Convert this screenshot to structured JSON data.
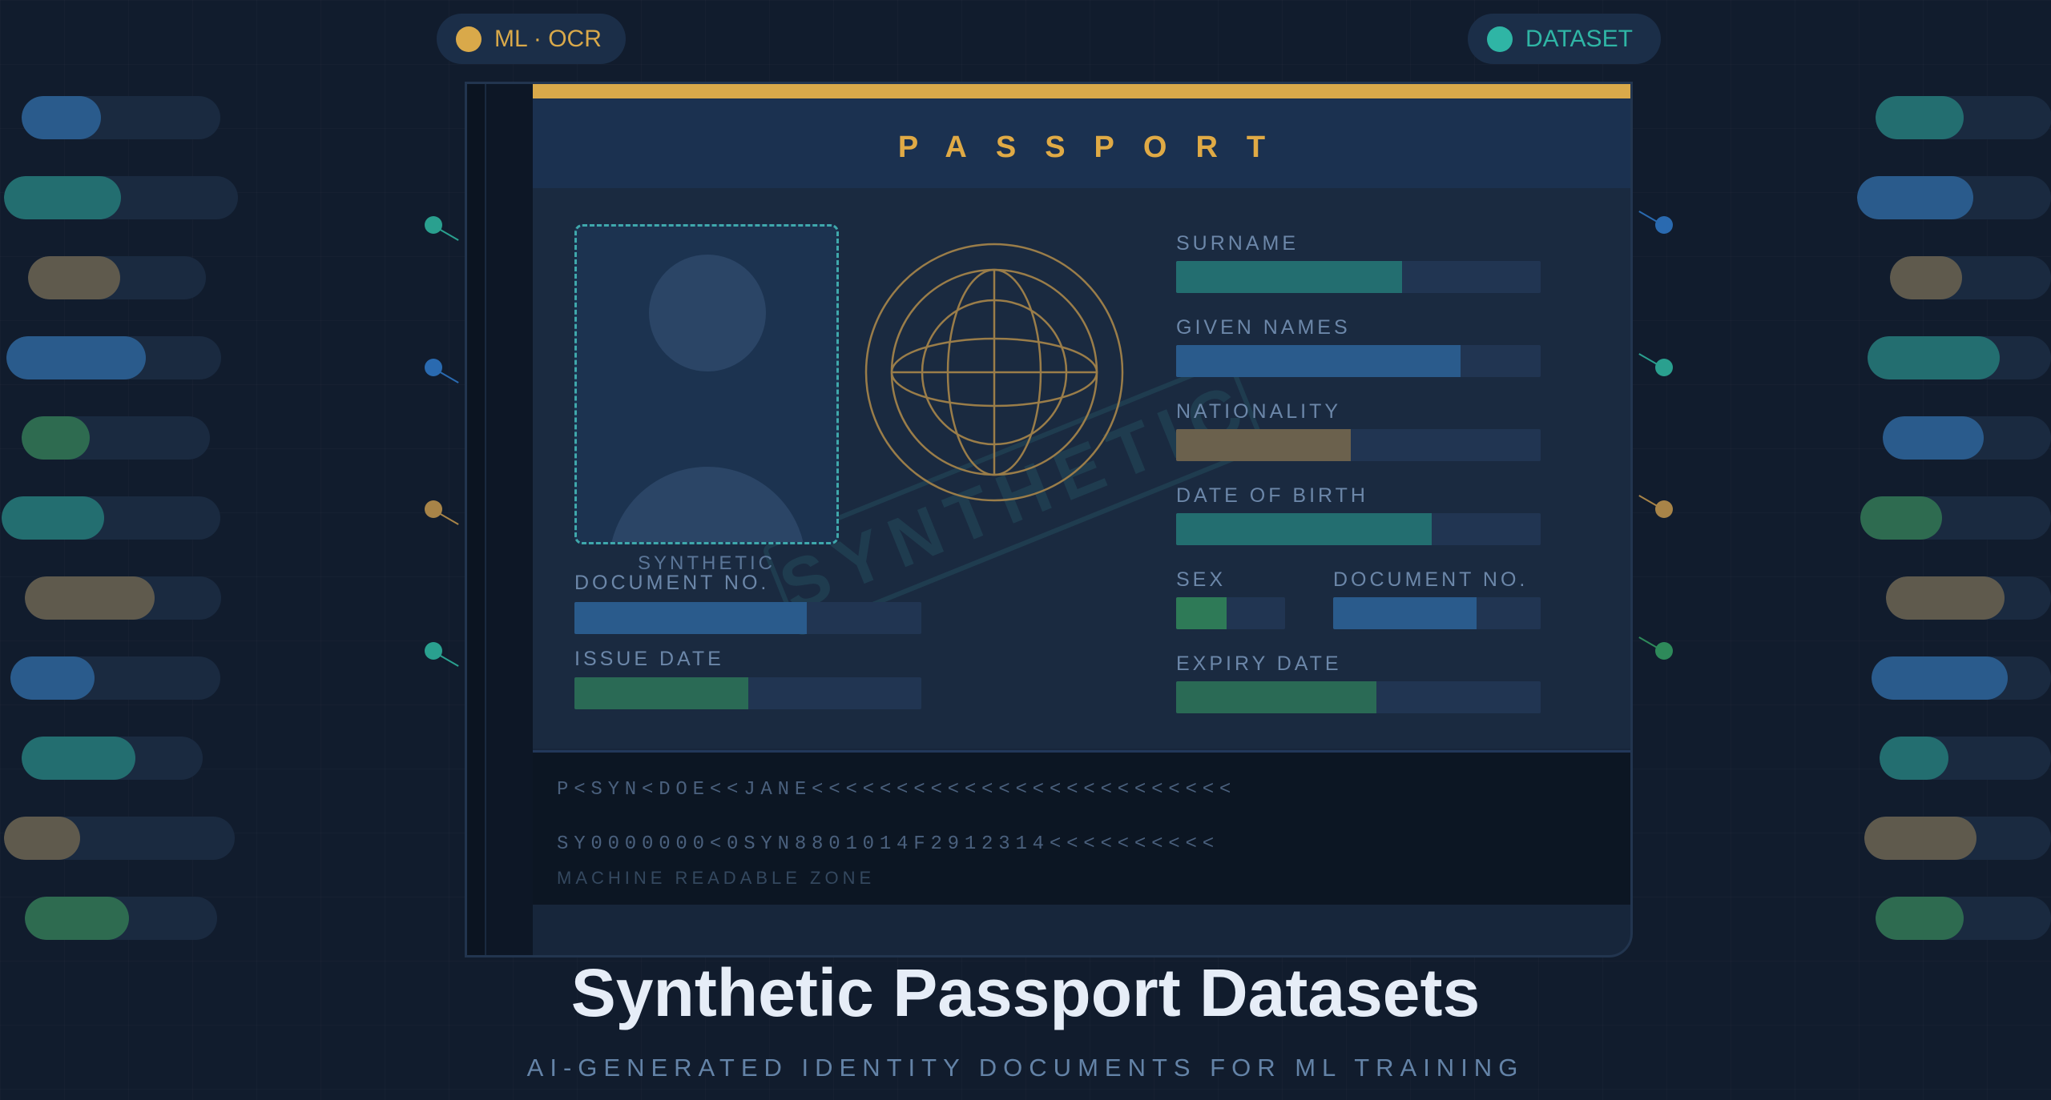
{
  "badges": {
    "left": {
      "label": "ML · OCR",
      "dot_color": "#d9a94a"
    },
    "right": {
      "label": "DATASET",
      "dot_color": "#2fb5a5"
    }
  },
  "passport": {
    "header": "PASSPORT",
    "photo_label": "SYNTHETIC",
    "watermark": "SYNTHETIC",
    "fields": {
      "surname": {
        "label": "SURNAME",
        "fill": 0.62,
        "color": "#236e70"
      },
      "given_names": {
        "label": "GIVEN NAMES",
        "fill": 0.78,
        "color": "#2a5b8c"
      },
      "nationality": {
        "label": "NATIONALITY",
        "fill": 0.48,
        "color": "#6b614d"
      },
      "date_of_birth": {
        "label": "DATE OF BIRTH",
        "fill": 0.7,
        "color": "#236e70"
      },
      "sex": {
        "label": "SEX",
        "fill": 0.46,
        "color": "#2e7a57"
      },
      "document_no_right": {
        "label": "DOCUMENT NO.",
        "fill": 0.69,
        "color": "#2a5b8c"
      },
      "expiry_date": {
        "label": "EXPIRY DATE",
        "fill": 0.55,
        "color": "#2a6a55"
      },
      "document_no_left": {
        "label": "DOCUMENT NO.",
        "fill": 0.67,
        "color": "#2a5b8c"
      },
      "issue_date": {
        "label": "ISSUE DATE",
        "fill": 0.5,
        "color": "#2a6a55"
      }
    },
    "mrz": {
      "line1": "P<SYN<DOE<<JANE<<<<<<<<<<<<<<<<<<<<<<<<<",
      "line2": "SY0000000<0SYN8801014F2912314<<<<<<<<<<",
      "caption": "MACHINE READABLE ZONE"
    }
  },
  "title": "Synthetic Passport Datasets",
  "subtitle": "AI-GENERATED IDENTITY DOCUMENTS FOR ML TRAINING"
}
